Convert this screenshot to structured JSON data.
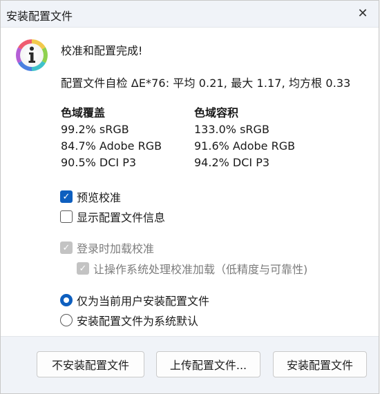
{
  "window": {
    "title": "安装配置文件",
    "close_glyph": "✕"
  },
  "icon": "info-icon",
  "result": {
    "headline": "校准和配置完成!",
    "self_check": "配置文件自检 ΔE*76: 平均 0.21, 最大 1.17, 均方根 0.33"
  },
  "gamut": {
    "coverage": {
      "heading": "色域覆盖",
      "rows": [
        "99.2% sRGB",
        "84.7% Adobe RGB",
        "90.5% DCI P3"
      ]
    },
    "volume": {
      "heading": "色域容积",
      "rows": [
        "133.0% sRGB",
        "91.6% Adobe RGB",
        "94.2% DCI P3"
      ]
    }
  },
  "options": {
    "preview_calibration": {
      "label": "预览校准",
      "checked": true
    },
    "show_profile_info": {
      "label": "显示配置文件信息",
      "checked": false
    },
    "load_on_login": {
      "label": "登录时加载校准",
      "checked": true,
      "enabled": false
    },
    "os_handle_loading": {
      "label": "让操作系统处理校准加载（低精度与可靠性)",
      "checked": true,
      "enabled": false
    }
  },
  "install_scope": {
    "current_user": {
      "label": "仅为当前用户安装配置文件",
      "selected": true
    },
    "system_default": {
      "label": "安装配置文件为系统默认",
      "selected": false
    }
  },
  "buttons": {
    "dont_install": "不安装配置文件",
    "upload": "上传配置文件...",
    "install": "安装配置文件"
  },
  "colors": {
    "accent": "#0e5fbf",
    "disabled_check": "#c3c3c3"
  }
}
